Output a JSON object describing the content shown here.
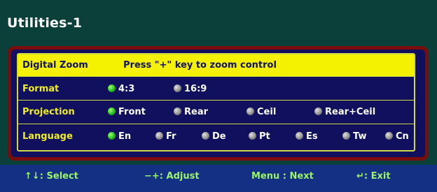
{
  "window": {
    "title": "Utilities-1"
  },
  "digital_zoom": {
    "label": "Digital Zoom",
    "hint": "Press \"+\" key to zoom control"
  },
  "format": {
    "label": "Format",
    "options": [
      "4:3",
      "16:9"
    ],
    "selected": "4:3"
  },
  "projection": {
    "label": "Projection",
    "options": [
      "Front",
      "Rear",
      "Ceil",
      "Rear+Ceil"
    ],
    "selected": "Front"
  },
  "language": {
    "label": "Language",
    "options": [
      "En",
      "Fr",
      "De",
      "Pt",
      "Es",
      "Tw",
      "Cn"
    ],
    "selected": "En"
  },
  "footer": {
    "select": ": Select",
    "adjust": ": Adjust",
    "next": "Menu : Next",
    "exit": ": Exit"
  },
  "colors": {
    "accent": "#f4f200",
    "panel": "#10105e",
    "border": "#7b0c0c",
    "footer": "#133084",
    "footer_text": "#9cf36a"
  }
}
